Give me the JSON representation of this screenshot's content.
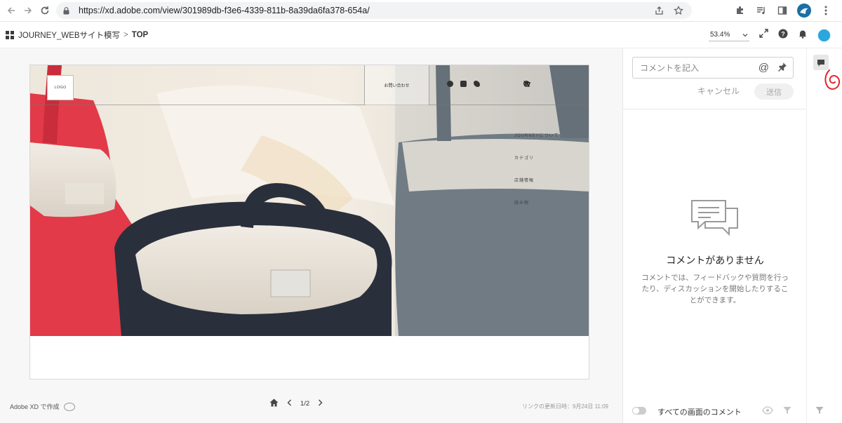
{
  "browser": {
    "url": "https://xd.adobe.com/view/301989db-f3e6-4339-811b-8a39da6fa378-654a/"
  },
  "xd": {
    "project": "JOURNEY_WEBサイト模写",
    "separator": ">",
    "current": "TOP",
    "zoom": "53.4%"
  },
  "artboard": {
    "logo": "LOGO",
    "contact": "お問い合わせ",
    "menu": [
      "JOURNEYについて",
      "カテゴリ",
      "店舗情報",
      "読み物"
    ]
  },
  "canvas_footer": {
    "made_with": "Adobe XD で作成",
    "page": "1/2",
    "updated": "リンクの更新日時：9月24日 11:09"
  },
  "comments": {
    "placeholder": "コメントを記入",
    "cancel": "キャンセル",
    "send": "送信",
    "empty_title": "コメントがありません",
    "empty_desc": "コメントでは、フィードバックや質問を行ったり、ディスカッションを開始したりすることができます。",
    "all_screens": "すべての画面のコメント"
  },
  "icons": {
    "back": "arrow-left-icon",
    "forward": "arrow-right-icon",
    "reload": "reload-icon",
    "lock": "lock-icon",
    "share": "share-icon",
    "bookmark": "star-icon",
    "extensions": "puzzle-icon",
    "media": "media-queue-icon",
    "sidepanel": "side-panel-icon",
    "menu": "kebab-menu-icon"
  },
  "colors": {
    "xd_avatar": "#2aa7dc",
    "scribble": "#e0262b",
    "tote_red": "#e23a48",
    "tote_navy": "#2a2f3c",
    "tote_gray": "#6f7a83"
  }
}
